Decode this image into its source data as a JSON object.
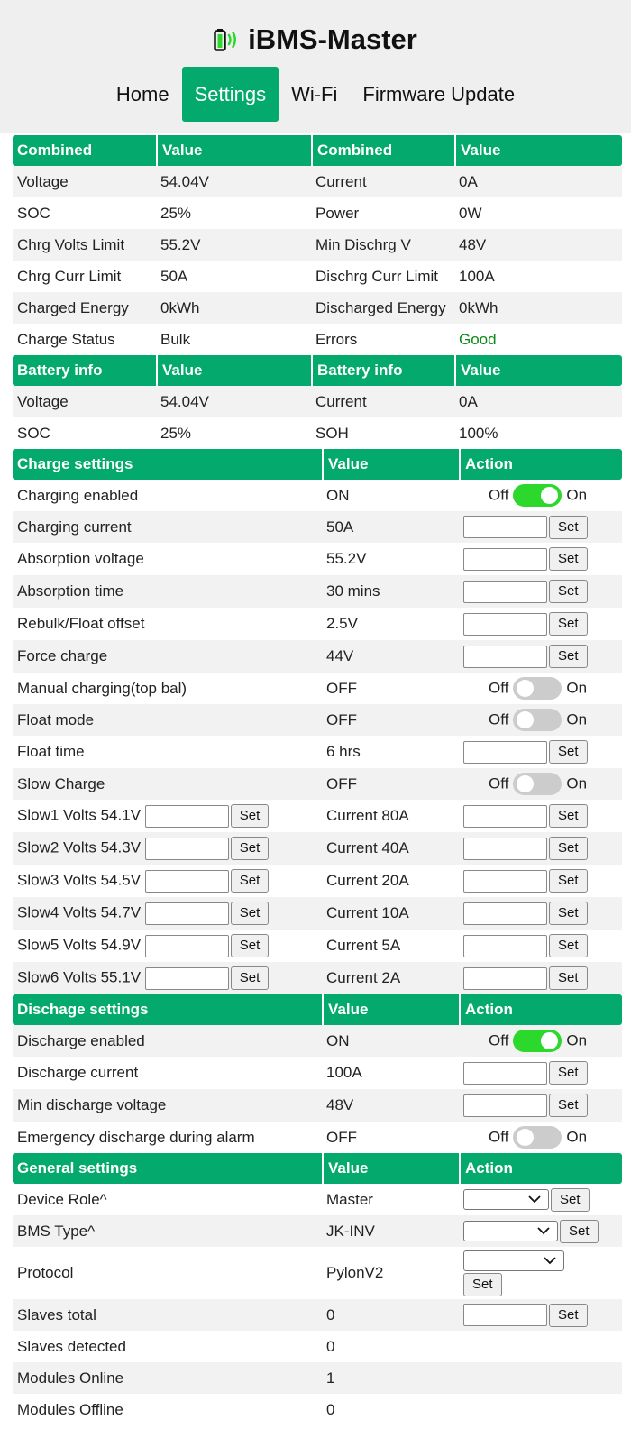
{
  "header": {
    "title": "iBMS-Master"
  },
  "nav": [
    {
      "label": "Home"
    },
    {
      "label": "Settings"
    },
    {
      "label": "Wi-Fi"
    },
    {
      "label": "Firmware Update"
    }
  ],
  "combined": {
    "headers": [
      "Combined",
      "Value",
      "Combined",
      "Value"
    ],
    "rows": [
      [
        "Voltage",
        "54.04V",
        "Current",
        "0A"
      ],
      [
        "SOC",
        "25%",
        "Power",
        "0W"
      ],
      [
        "Chrg Volts Limit",
        "55.2V",
        "Min Dischrg V",
        "48V"
      ],
      [
        "Chrg Curr Limit",
        "50A",
        "Dischrg Curr Limit",
        "100A"
      ],
      [
        "Charged Energy",
        "0kWh",
        "Discharged Energy",
        "0kWh"
      ],
      [
        "Charge Status",
        "Bulk",
        "Errors",
        "Good"
      ]
    ]
  },
  "battery": {
    "headers": [
      "Battery info",
      "Value",
      "Battery info",
      "Value"
    ],
    "rows": [
      [
        "Voltage",
        "54.04V",
        "Current",
        "0A"
      ],
      [
        "SOC",
        "25%",
        "SOH",
        "100%"
      ]
    ]
  },
  "charge": {
    "headers": [
      "Charge settings",
      "Value",
      "Action"
    ],
    "rows": [
      [
        "Charging enabled",
        "ON"
      ],
      [
        "Charging current",
        "50A"
      ],
      [
        "Absorption voltage",
        "55.2V"
      ],
      [
        "Absorption time",
        "30 mins"
      ],
      [
        "Rebulk/Float offset",
        "2.5V"
      ],
      [
        "Force charge",
        "44V"
      ],
      [
        "Manual charging(top bal)",
        "OFF"
      ],
      [
        "Float mode",
        "OFF"
      ],
      [
        "Float time",
        "6 hrs"
      ],
      [
        "Slow Charge",
        "OFF"
      ]
    ],
    "slow": [
      [
        "Slow1 Volts 54.1V",
        "Current 80A"
      ],
      [
        "Slow2 Volts 54.3V",
        "Current 40A"
      ],
      [
        "Slow3 Volts 54.5V",
        "Current 20A"
      ],
      [
        "Slow4 Volts 54.7V",
        "Current 10A"
      ],
      [
        "Slow5 Volts 54.9V",
        "Current 5A"
      ],
      [
        "Slow6 Volts 55.1V",
        "Current 2A"
      ]
    ]
  },
  "discharge": {
    "headers": [
      "Dischage settings",
      "Value",
      "Action"
    ],
    "rows": [
      [
        "Discharge enabled",
        "ON"
      ],
      [
        "Discharge current",
        "100A"
      ],
      [
        "Min discharge voltage",
        "48V"
      ],
      [
        "Emergency discharge during alarm",
        "OFF"
      ]
    ]
  },
  "general": {
    "headers": [
      "General settings",
      "Value",
      "Action"
    ],
    "rows": [
      [
        "Device Role^",
        "Master"
      ],
      [
        "BMS Type^",
        "JK-INV"
      ],
      [
        "Protocol",
        "PylonV2"
      ],
      [
        "Slaves total",
        "0"
      ],
      [
        "Slaves detected",
        "0"
      ],
      [
        "Modules Online",
        "1"
      ],
      [
        "Modules Offline",
        "0"
      ]
    ]
  },
  "controls": {
    "off": "Off",
    "on": "On",
    "set": "Set"
  },
  "colors": {
    "accent": "#04aa6d",
    "toggle_on": "#2dd82d",
    "toggle_off": "#cccccc",
    "good": "#0a8a16"
  },
  "icons": {
    "logo": "battery-charging-icon",
    "dropdown": "chevron-down-icon"
  }
}
